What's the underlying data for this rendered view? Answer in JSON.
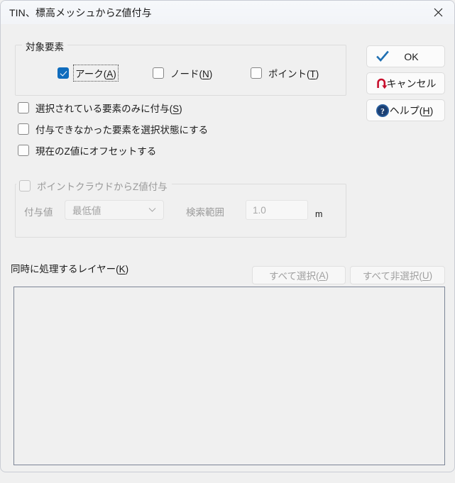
{
  "window": {
    "title": "TIN、標高メッシュからZ値付与",
    "close_icon": "close-icon"
  },
  "target_group": {
    "legend": "対象要素",
    "checkboxes": [
      {
        "label": "アーク(",
        "accel": "A",
        "suffix": ")",
        "checked": true,
        "focused": true,
        "enabled": true
      },
      {
        "label": "ノード(",
        "accel": "N",
        "suffix": ")",
        "checked": false,
        "focused": false,
        "enabled": true
      },
      {
        "label": "ポイント(",
        "accel": "T",
        "suffix": ")",
        "checked": false,
        "focused": false,
        "enabled": true
      }
    ]
  },
  "options": [
    {
      "label": "選択されている要素のみに付与(",
      "accel": "S",
      "suffix": ")",
      "checked": false
    },
    {
      "label": "付与できなかった要素を選択状態にする",
      "accel": "",
      "suffix": "",
      "checked": false
    },
    {
      "label": "現在のZ値にオフセットする",
      "accel": "",
      "suffix": "",
      "checked": false
    }
  ],
  "pointcloud_group": {
    "legend": "ポイントクラウドからZ値付与",
    "enabled": false,
    "checked": false,
    "value_label": "付与値",
    "value_combo": "最低値",
    "combo_icon": "chevron-down-icon",
    "range_label": "検索範囲",
    "range_value": "1.0",
    "unit_label": "m"
  },
  "layers": {
    "label": "同時に処理するレイヤー(",
    "accel": "K",
    "suffix": ")",
    "select_all": "すべて選択(",
    "select_all_accel": "A",
    "select_all_suffix": ")",
    "deselect_all": "すべて非選択(",
    "deselect_all_accel": "U",
    "deselect_all_suffix": ")",
    "items": []
  },
  "buttons": {
    "ok": {
      "label": "OK",
      "icon": "blue-check-icon"
    },
    "cancel": {
      "label": "キャンセル",
      "icon": "red-undo-arrow-icon"
    },
    "help": {
      "label": "ヘルプ(",
      "accel": "H",
      "suffix": ")",
      "icon": "blue-question-circle-icon"
    }
  },
  "colors": {
    "accent": "#0f6cbd",
    "check_icon": "#1f6fb2",
    "cancel_icon": "#c8102e",
    "help_icon": "#1b3f72",
    "disabled_text": "#9a9a9a"
  }
}
